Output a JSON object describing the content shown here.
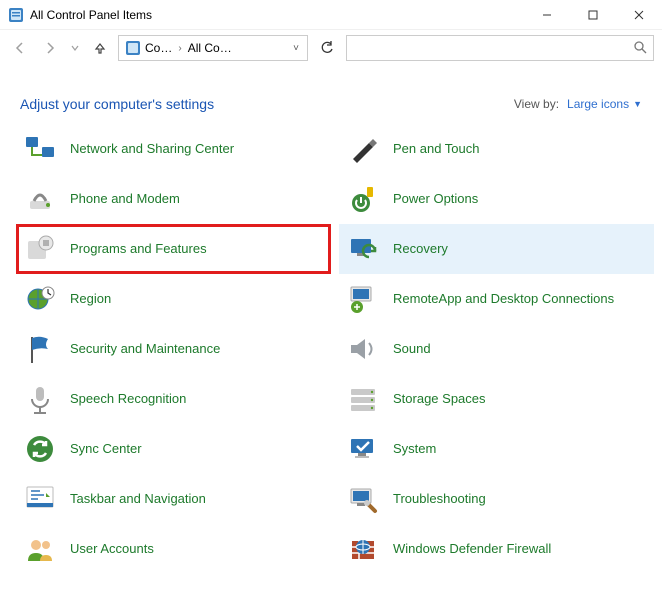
{
  "window": {
    "title": "All Control Panel Items"
  },
  "address": {
    "seg1": "Co…",
    "seg2": "All Co…"
  },
  "heading": "Adjust your computer's settings",
  "viewby": {
    "label": "View by:",
    "value": "Large icons"
  },
  "items": {
    "left": [
      {
        "id": "network-sharing",
        "label": "Network and Sharing Center"
      },
      {
        "id": "phone-modem",
        "label": "Phone and Modem"
      },
      {
        "id": "programs-features",
        "label": "Programs and Features"
      },
      {
        "id": "region",
        "label": "Region"
      },
      {
        "id": "security-maint",
        "label": "Security and Maintenance"
      },
      {
        "id": "speech",
        "label": "Speech Recognition"
      },
      {
        "id": "sync-center",
        "label": "Sync Center"
      },
      {
        "id": "taskbar-nav",
        "label": "Taskbar and Navigation"
      },
      {
        "id": "user-accounts",
        "label": "User Accounts"
      }
    ],
    "right": [
      {
        "id": "pen-touch",
        "label": "Pen and Touch"
      },
      {
        "id": "power-options",
        "label": "Power Options"
      },
      {
        "id": "recovery",
        "label": "Recovery"
      },
      {
        "id": "remoteapp",
        "label": "RemoteApp and Desktop Connections"
      },
      {
        "id": "sound",
        "label": "Sound"
      },
      {
        "id": "storage-spaces",
        "label": "Storage Spaces"
      },
      {
        "id": "system",
        "label": "System"
      },
      {
        "id": "troubleshooting",
        "label": "Troubleshooting"
      },
      {
        "id": "defender-firewall",
        "label": "Windows Defender Firewall"
      }
    ]
  }
}
